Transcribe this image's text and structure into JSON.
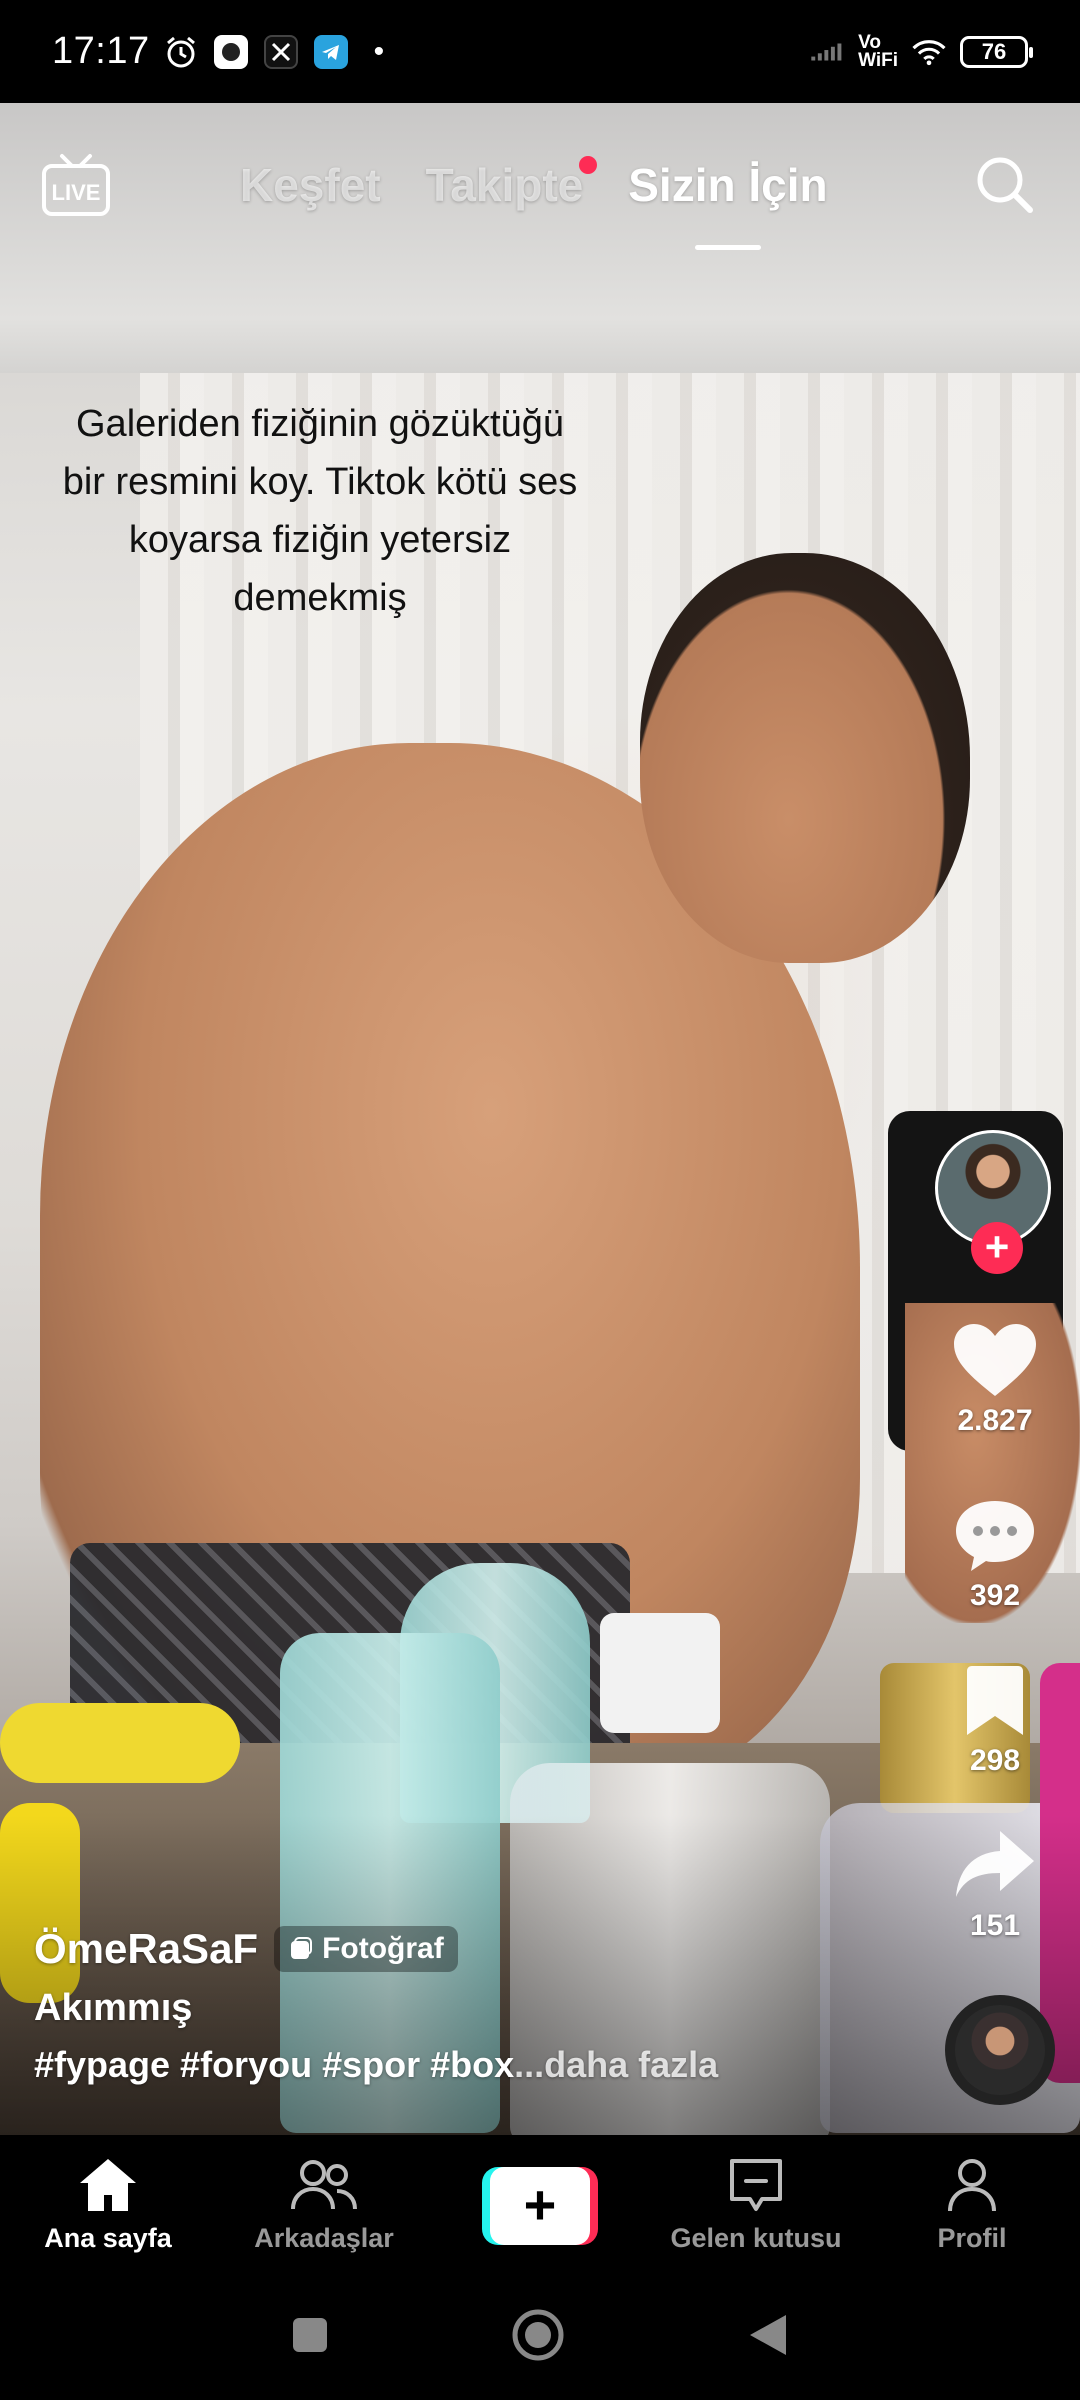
{
  "status_bar": {
    "time": "17:17",
    "network": "Vo\nWiFi",
    "battery": "76"
  },
  "top_bar": {
    "live_label": "LIVE",
    "tabs": [
      {
        "label": "Keşfet",
        "active": false
      },
      {
        "label": "Takipte",
        "active": false,
        "has_notification_dot": true
      },
      {
        "label": "Sizin İçin",
        "active": true
      }
    ]
  },
  "video": {
    "caption": "Galeriden fiziğinin gözüktüğü bir resmini koy. Tiktok kötü ses koyarsa fiziğin yetersiz demekmiş"
  },
  "actions": {
    "likes": "2.827",
    "comments": "392",
    "saves": "298",
    "shares": "151"
  },
  "post": {
    "author": "ÖmeRaSaF",
    "badge": "Fotoğraf",
    "description": "Akımmış",
    "hashtags": "#fypage #foryou #spor #box",
    "more": "...daha fazla"
  },
  "bottom_nav": [
    {
      "label": "Ana sayfa",
      "icon": "home-icon",
      "active": true
    },
    {
      "label": "Arkadaşlar",
      "icon": "friends-icon",
      "active": false
    },
    {
      "label": "",
      "icon": "create-icon",
      "active": false
    },
    {
      "label": "Gelen kutusu",
      "icon": "inbox-icon",
      "active": false
    },
    {
      "label": "Profil",
      "icon": "profile-icon",
      "active": false
    }
  ],
  "colors": {
    "accent": "#fe2c55",
    "cyan": "#25f4ee"
  }
}
